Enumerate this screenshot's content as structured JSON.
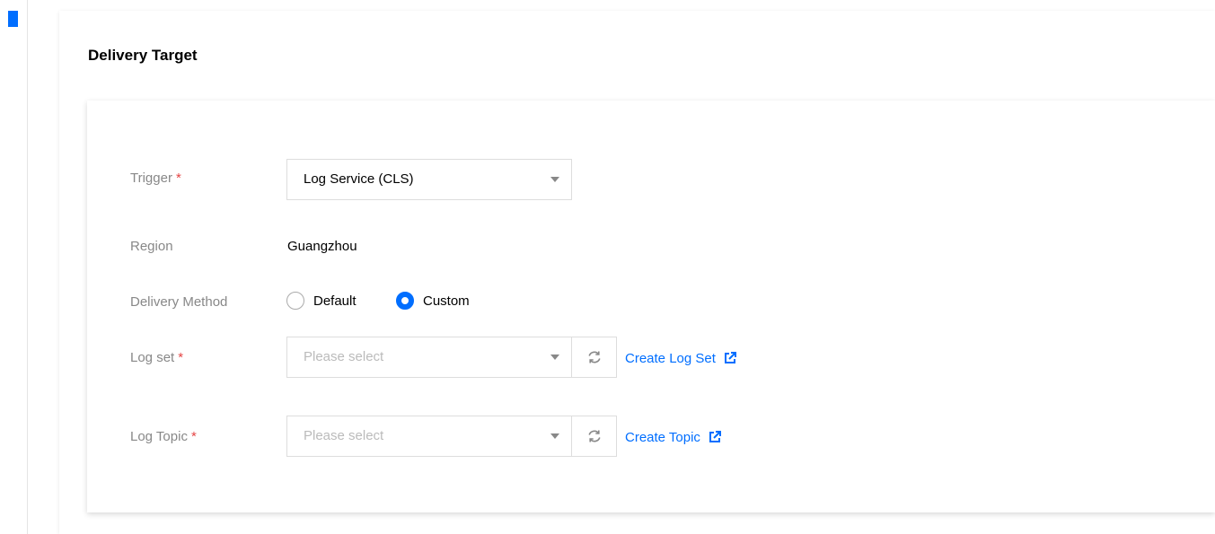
{
  "section": {
    "title": "Delivery Target"
  },
  "form": {
    "trigger": {
      "label": "Trigger",
      "required": "*",
      "value": "Log Service (CLS)"
    },
    "region": {
      "label": "Region",
      "value": "Guangzhou"
    },
    "delivery_method": {
      "label": "Delivery Method",
      "options": [
        {
          "label": "Default",
          "selected": false
        },
        {
          "label": "Custom",
          "selected": true
        }
      ]
    },
    "log_set": {
      "label": "Log set",
      "required": "*",
      "placeholder": "Please select",
      "create_link": "Create Log Set"
    },
    "log_topic": {
      "label": "Log Topic",
      "required": "*",
      "placeholder": "Please select",
      "create_link": "Create Topic"
    }
  },
  "icons": {
    "caret": "chevron-down-icon",
    "refresh": "refresh-icon",
    "external": "external-link-icon"
  },
  "colors": {
    "accent": "#006eff",
    "required": "#e54545",
    "label": "#888888",
    "placeholder": "#bbbbbb"
  }
}
